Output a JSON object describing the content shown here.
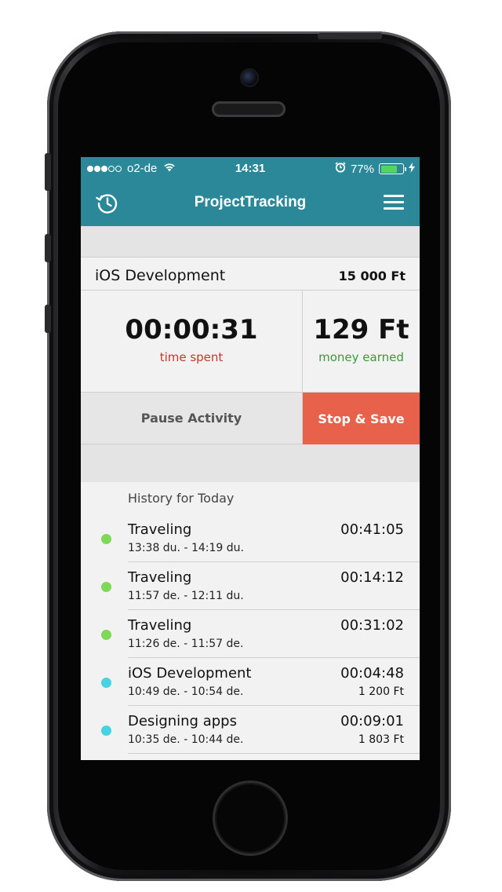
{
  "status_bar": {
    "carrier": "o2-de",
    "time": "14:31",
    "battery": "77%",
    "battery_level": 0.77,
    "signal_bars": 3,
    "signal_total": 5,
    "colors": {
      "battery_fill": "#52d65b"
    }
  },
  "navbar": {
    "title": "ProjectTracking",
    "left_icon": "history-clock-icon",
    "right_icon": "hamburger-menu-icon",
    "background": "#2b8898"
  },
  "current_project": {
    "name": "iOS Development",
    "rate": "15 000 Ft"
  },
  "stats": {
    "time_value": "00:00:31",
    "time_label": "time spent",
    "money_value": "129 Ft",
    "money_label": "money earned"
  },
  "actions": {
    "pause_label": "Pause Activity",
    "stop_label": "Stop & Save",
    "stop_color": "#e8614a"
  },
  "history": {
    "header": "History for Today",
    "items": [
      {
        "name": "Traveling",
        "range": "13:38 du. - 14:19 du.",
        "duration": "00:41:05",
        "money": "",
        "dot_color": "#7ed957"
      },
      {
        "name": "Traveling",
        "range": "11:57 de. - 12:11 du.",
        "duration": "00:14:12",
        "money": "",
        "dot_color": "#7ed957"
      },
      {
        "name": "Traveling",
        "range": "11:26 de. - 11:57 de.",
        "duration": "00:31:02",
        "money": "",
        "dot_color": "#7ed957"
      },
      {
        "name": "iOS Development",
        "range": "10:49 de. - 10:54 de.",
        "duration": "00:04:48",
        "money": "1 200 Ft",
        "dot_color": "#45d3e3"
      },
      {
        "name": "Designing apps",
        "range": "10:35 de. - 10:44 de.",
        "duration": "00:09:01",
        "money": "1 803 Ft",
        "dot_color": "#45d3e3"
      }
    ]
  }
}
